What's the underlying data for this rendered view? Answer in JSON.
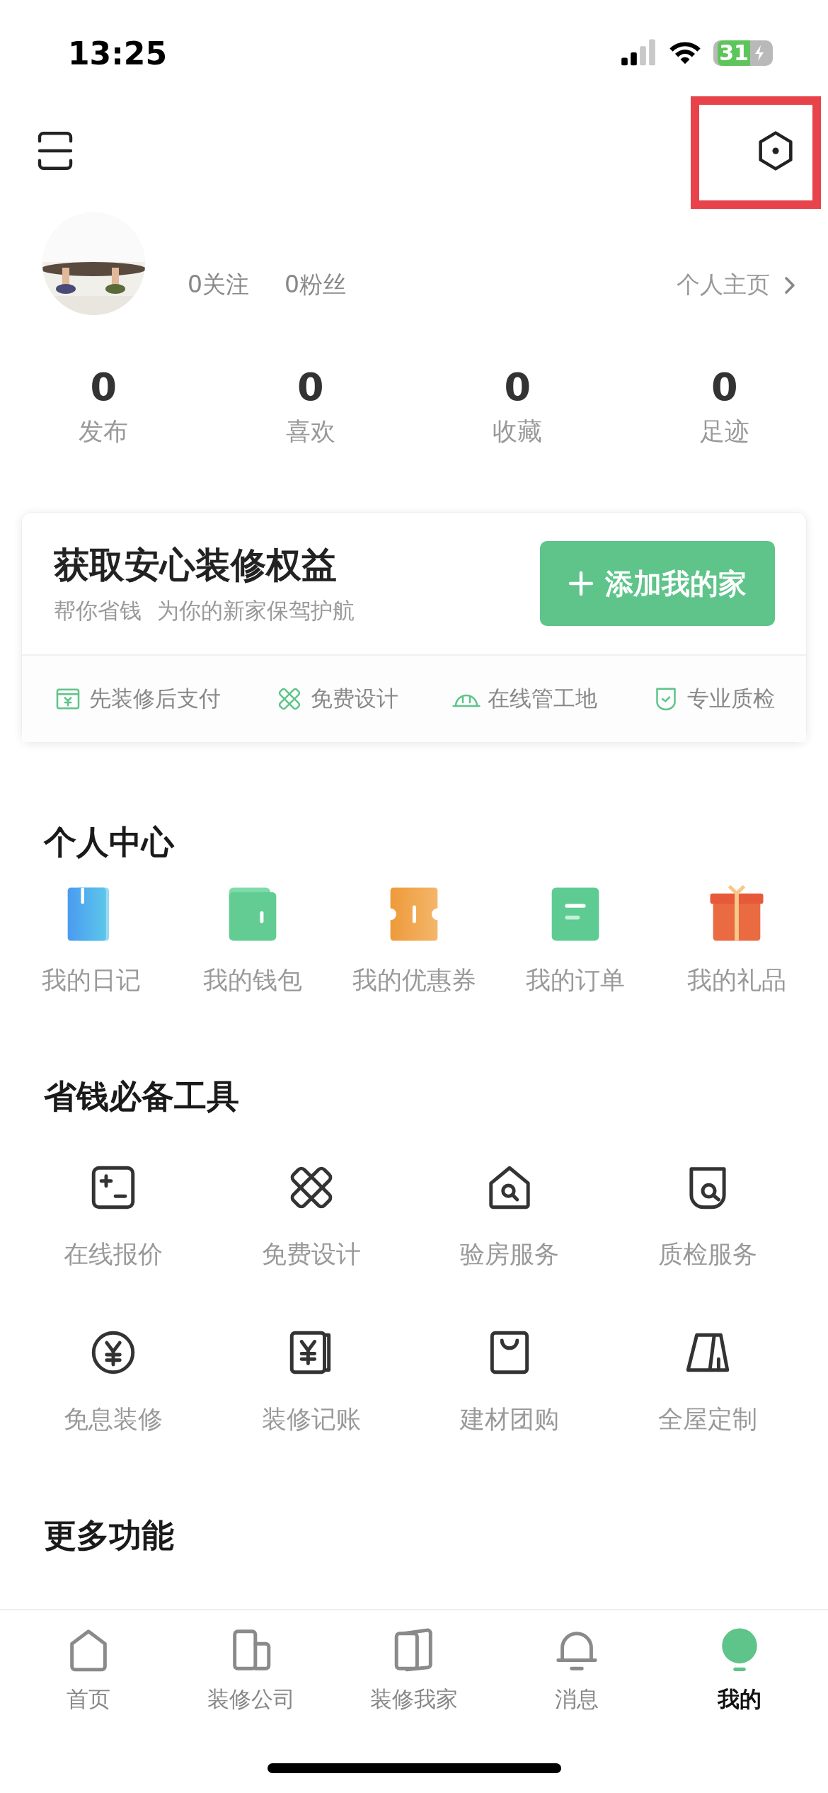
{
  "status_bar": {
    "time": "13:25",
    "battery": "31"
  },
  "profile": {
    "following": "0关注",
    "followers": "0粉丝",
    "homepage_link": "个人主页"
  },
  "stats": [
    {
      "value": "0",
      "label": "发布"
    },
    {
      "value": "0",
      "label": "喜欢"
    },
    {
      "value": "0",
      "label": "收藏"
    },
    {
      "value": "0",
      "label": "足迹"
    }
  ],
  "promo_card": {
    "title": "获取安心装修权益",
    "subtitle": "帮你省钱 为你的新家保驾护航",
    "button": "添加我的家",
    "features": [
      "先装修后支付",
      "免费设计",
      "在线管工地",
      "专业质检"
    ]
  },
  "personal_center": {
    "title": "个人中心",
    "items": [
      "我的日记",
      "我的钱包",
      "我的优惠券",
      "我的订单",
      "我的礼品"
    ]
  },
  "tools": {
    "title": "省钱必备工具",
    "items": [
      "在线报价",
      "免费设计",
      "验房服务",
      "质检服务",
      "免息装修",
      "装修记账",
      "建材团购",
      "全屋定制"
    ]
  },
  "more": {
    "title": "更多功能"
  },
  "tab_bar": [
    {
      "label": "首页",
      "selected": false
    },
    {
      "label": "装修公司",
      "selected": false
    },
    {
      "label": "装修我家",
      "selected": false
    },
    {
      "label": "消息",
      "selected": false
    },
    {
      "label": "我的",
      "selected": true
    }
  ]
}
